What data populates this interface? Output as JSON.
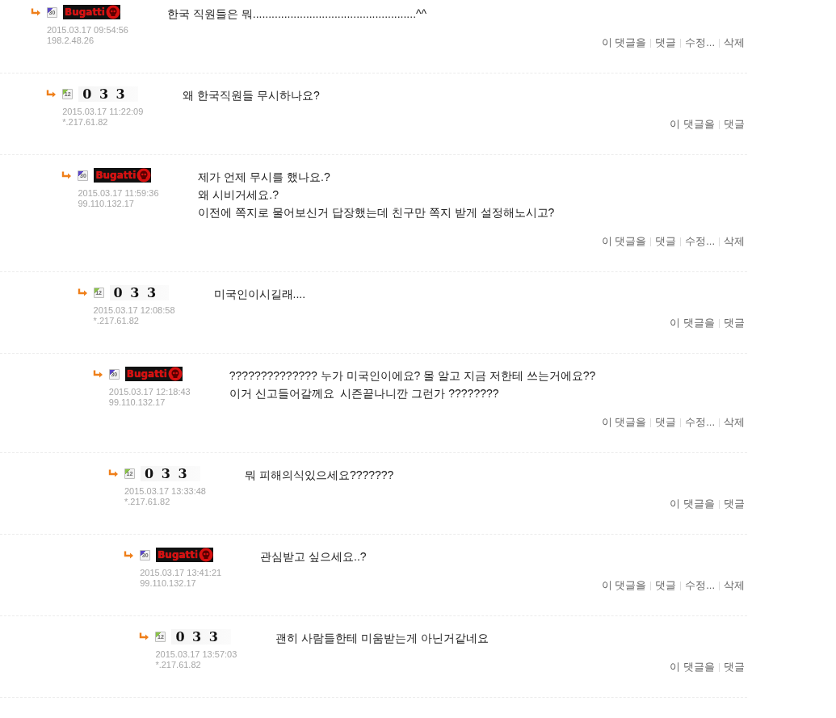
{
  "comments": [
    {
      "author": {
        "name": "Bugatti",
        "kind": "skull"
      },
      "badge": {
        "text": "30",
        "color": "#5b47c9"
      },
      "date": "2015.03.17 09:54:56",
      "ip": "198.2.48.26",
      "text": "한국 직원들은 뭐....................................................^^",
      "actions": [
        "이 댓글을",
        "댓글",
        "수정...",
        "삭제"
      ],
      "children": [
        {
          "author": {
            "name": "0 3 3",
            "kind": "bold"
          },
          "badge": {
            "text": "12",
            "color": "#8bc34a"
          },
          "date": "2015.03.17 11:22:09",
          "ip": "*.217.61.82",
          "text": "왜 한국직원들 무시하나요?",
          "actions": [
            "이 댓글을",
            "댓글"
          ],
          "children": [
            {
              "author": {
                "name": "Bugatti",
                "kind": "skull"
              },
              "badge": {
                "text": "30",
                "color": "#5b47c9"
              },
              "date": "2015.03.17 11:59:36",
              "ip": "99.110.132.17",
              "text": "제가 언제 무시를 했나요.?\n왜 시비거세요.?\n이전에 쪽지로 물어보신거 답장했는데 친구만 쪽지 받게 설정해노시고?",
              "actions": [
                "이 댓글을",
                "댓글",
                "수정...",
                "삭제"
              ],
              "children": [
                {
                  "author": {
                    "name": "0 3 3",
                    "kind": "bold"
                  },
                  "badge": {
                    "text": "12",
                    "color": "#8bc34a"
                  },
                  "date": "2015.03.17 12:08:58",
                  "ip": "*.217.61.82",
                  "text": "미국인이시길래....",
                  "actions": [
                    "이 댓글을",
                    "댓글"
                  ],
                  "children": [
                    {
                      "author": {
                        "name": "Bugatti",
                        "kind": "skull"
                      },
                      "badge": {
                        "text": "30",
                        "color": "#5b47c9"
                      },
                      "date": "2015.03.17 12:18:43",
                      "ip": "99.110.132.17",
                      "text": "?????????????? 누가 미국인이에요? 몰 알고 지금 저한테 쓰는거에요??\n이거 신고들어갈께요  시즌끝나니깐 그런가 ????????",
                      "actions": [
                        "이 댓글을",
                        "댓글",
                        "수정...",
                        "삭제"
                      ],
                      "children": [
                        {
                          "author": {
                            "name": "0 3 3",
                            "kind": "bold"
                          },
                          "badge": {
                            "text": "12",
                            "color": "#8bc34a"
                          },
                          "date": "2015.03.17 13:33:48",
                          "ip": "*.217.61.82",
                          "text": "뭐 피해의식있으세요???????",
                          "actions": [
                            "이 댓글을",
                            "댓글"
                          ],
                          "children": [
                            {
                              "author": {
                                "name": "Bugatti",
                                "kind": "skull"
                              },
                              "badge": {
                                "text": "30",
                                "color": "#5b47c9"
                              },
                              "date": "2015.03.17 13:41:21",
                              "ip": "99.110.132.17",
                              "text": "관심받고 싶으세요..?",
                              "actions": [
                                "이 댓글을",
                                "댓글",
                                "수정...",
                                "삭제"
                              ],
                              "children": [
                                {
                                  "author": {
                                    "name": "0 3 3",
                                    "kind": "bold"
                                  },
                                  "badge": {
                                    "text": "12",
                                    "color": "#8bc34a"
                                  },
                                  "date": "2015.03.17 13:57:03",
                                  "ip": "*.217.61.82",
                                  "text": "괜히 사람들한테 미움받는게 아닌거같네요",
                                  "actions": [
                                    "이 댓글을",
                                    "댓글"
                                  ]
                                }
                              ]
                            }
                          ]
                        }
                      ]
                    }
                  ]
                }
              ]
            }
          ]
        }
      ]
    }
  ]
}
